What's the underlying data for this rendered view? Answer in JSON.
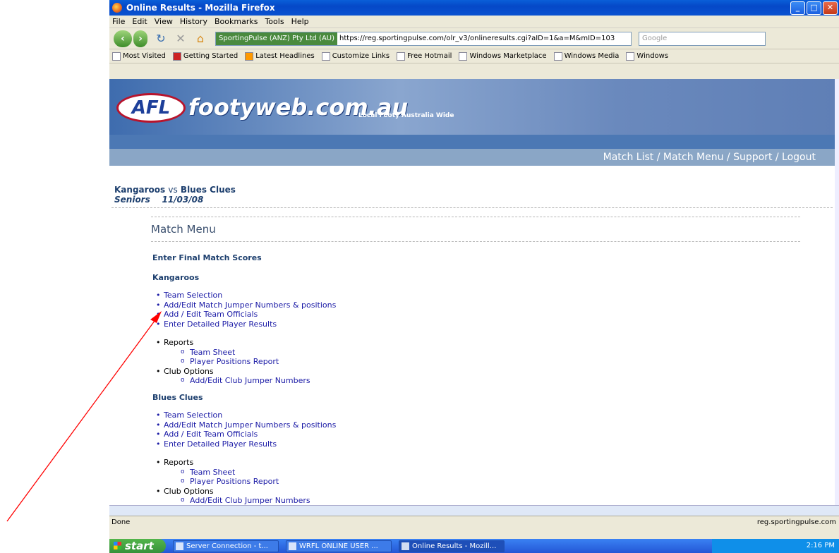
{
  "window": {
    "title": "Online Results - Mozilla Firefox"
  },
  "menubar": [
    "File",
    "Edit",
    "View",
    "History",
    "Bookmarks",
    "Tools",
    "Help"
  ],
  "navbar": {
    "site_identity": "SportingPulse (ANZ) Pty Ltd (AU)",
    "url": "https://reg.sportingpulse.com/olr_v3/onlineresults.cgi?aID=1&a=M&mID=103",
    "search_placeholder": "Google"
  },
  "bookmarks": [
    "Most Visited",
    "Getting Started",
    "Latest Headlines",
    "Customize Links",
    "Free Hotmail",
    "Windows Marketplace",
    "Windows Media",
    "Windows"
  ],
  "banner": {
    "badge": "AFL",
    "brand": "footyweb.com.au",
    "tagline": "Local Footy Australia Wide"
  },
  "toplinks": "Match List / Match Menu / Support / Logout",
  "match": {
    "home": "Kangaroos",
    "vs": "vs",
    "away": "Blues Clues",
    "grade": "Seniors",
    "date": "11/03/08"
  },
  "menu_title": "Match Menu",
  "enter_scores": "Enter Final Match Scores",
  "teams": [
    {
      "name": "Kangaroos",
      "items": [
        "Team Selection",
        "Add/Edit Match Jumper Numbers & positions",
        "Add / Edit Team Officials",
        "Enter Detailed Player Results"
      ],
      "reports_label": "Reports",
      "reports": [
        "Team Sheet",
        "Player Positions Report"
      ],
      "club_label": "Club Options",
      "club": [
        "Add/Edit Club Jumper Numbers"
      ]
    },
    {
      "name": "Blues Clues",
      "items": [
        "Team Selection",
        "Add/Edit Match Jumper Numbers & positions",
        "Add / Edit Team Officials",
        "Enter Detailed Player Results"
      ],
      "reports_label": "Reports",
      "reports": [
        "Team Sheet",
        "Player Positions Report"
      ],
      "club_label": "Club Options",
      "club": [
        "Add/Edit Club Jumper Numbers"
      ]
    }
  ],
  "status": {
    "left": "Done",
    "right": "reg.sportingpulse.com"
  },
  "taskbar": {
    "start": "start",
    "tasks": [
      "Server Connection - t...",
      "WRFL ONLINE USER ...",
      "Online Results - Mozill..."
    ],
    "clock": "2:16 PM"
  },
  "annotation_color": "#ff0000"
}
